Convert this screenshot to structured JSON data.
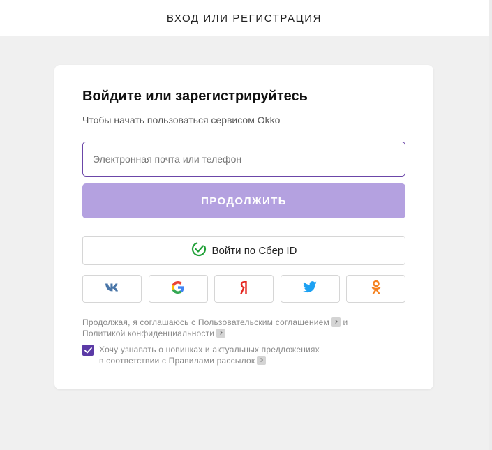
{
  "header": {
    "title": "ВХОД ИЛИ РЕГИСТРАЦИЯ"
  },
  "card": {
    "heading": "Войдите или зарегистрируйтесь",
    "subheading": "Чтобы начать пользоваться сервисом Okko",
    "login_input": {
      "placeholder": "Электронная почта или телефон",
      "value": ""
    },
    "continue_label": "ПРОДОЛЖИТЬ",
    "sber_label": "Войти по Сбер ID",
    "socials": [
      {
        "name": "vk-icon"
      },
      {
        "name": "google-icon"
      },
      {
        "name": "yandex-icon"
      },
      {
        "name": "twitter-icon"
      },
      {
        "name": "odnoklassniki-icon"
      }
    ],
    "terms": {
      "prefix": "Продолжая, я соглашаюсь с ",
      "user_agreement": "Пользовательским соглашением",
      "and": " и ",
      "privacy_policy": "Политикой конфиденциальности"
    },
    "subscribe": {
      "checked": true,
      "line1": "Хочу узнавать о новинках и актуальных предложениях",
      "line2": "в соответствии с Правилами рассылок"
    }
  },
  "colors": {
    "accent": "#5b3aa6",
    "input_border": "#6b46a8",
    "continue_button": "#b4a1e0",
    "page_background": "#f0f0f0"
  }
}
